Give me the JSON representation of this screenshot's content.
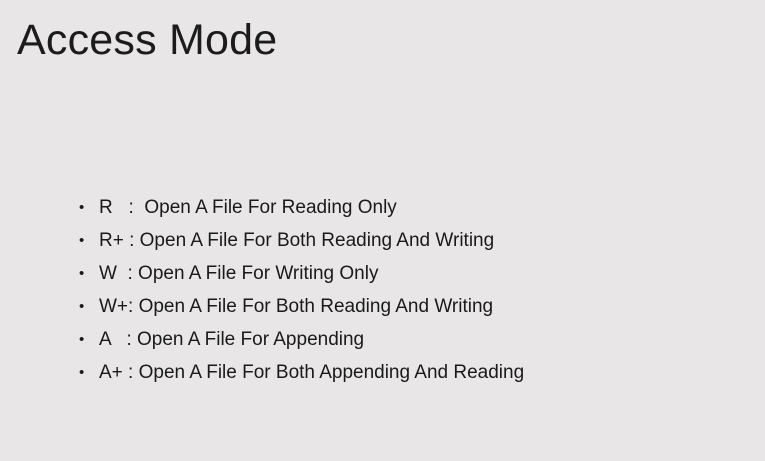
{
  "slide": {
    "title": "Access Mode",
    "bullet_symbol": "•",
    "items": [
      {
        "text": "R   :  Open A File For Reading Only"
      },
      {
        "text": "R+ : Open A File For Both Reading And Writing"
      },
      {
        "text": "W  : Open A File For Writing Only"
      },
      {
        "text": "W+: Open A File For Both Reading And Writing"
      },
      {
        "text": "A   : Open A File For Appending"
      },
      {
        "text": "A+ : Open A File For Both Appending And Reading"
      }
    ]
  },
  "colors": {
    "background": "#e8e6e6",
    "text": "#1a1a1a"
  }
}
